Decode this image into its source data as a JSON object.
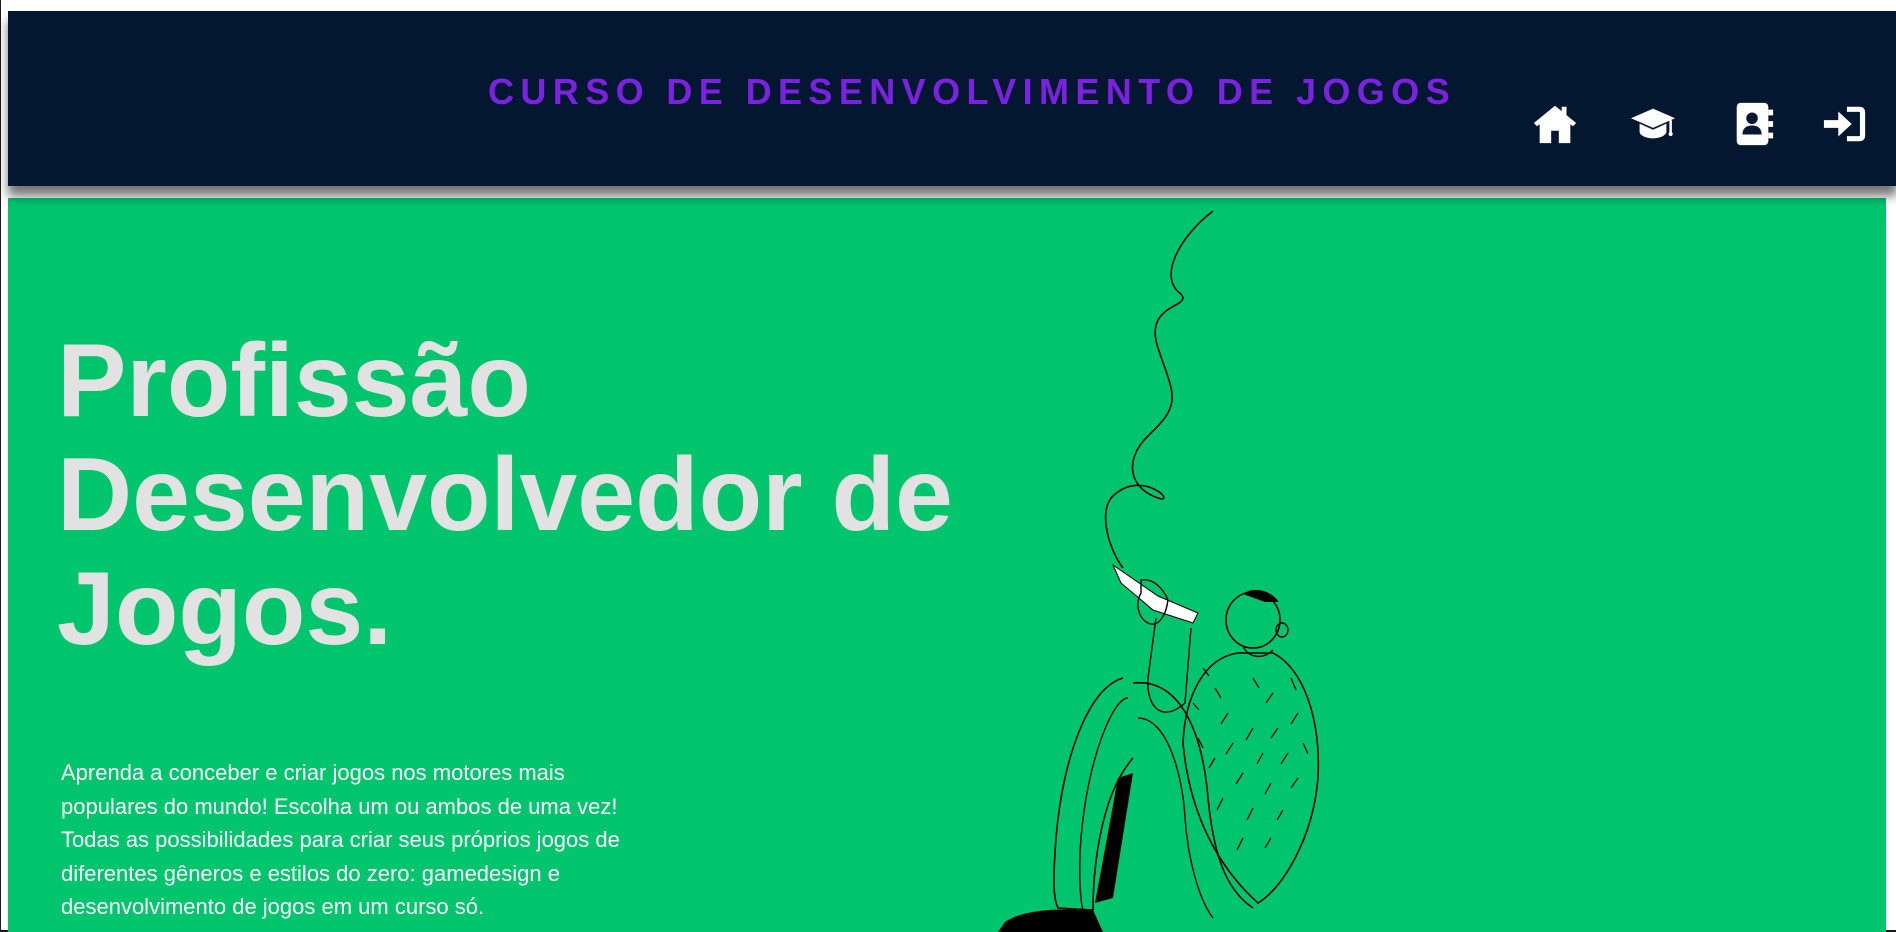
{
  "header": {
    "title": "CURSO DE DESENVOLVIMENTO DE JOGOS",
    "nav": [
      {
        "icon": "home-icon"
      },
      {
        "icon": "graduation-cap-icon"
      },
      {
        "icon": "contact-book-icon"
      },
      {
        "icon": "sign-in-icon"
      }
    ]
  },
  "hero": {
    "title_line1": "Profissão",
    "title_line2": "Desenvolvedor de",
    "title_line3": "Jogos.",
    "description": "Aprenda a conceber e criar jogos nos motores mais populares do mundo! Escolha um ou ambos de uma vez! Todas as possibilidades para criar seus próprios jogos de diferentes gêneros e estilos do zero: gamedesign e desenvolvimento de jogos em um curso só."
  },
  "colors": {
    "header_bg": "#041731",
    "title_accent": "#7a22e0",
    "hero_bg": "#00c56c",
    "hero_title": "#e2e2e2"
  }
}
